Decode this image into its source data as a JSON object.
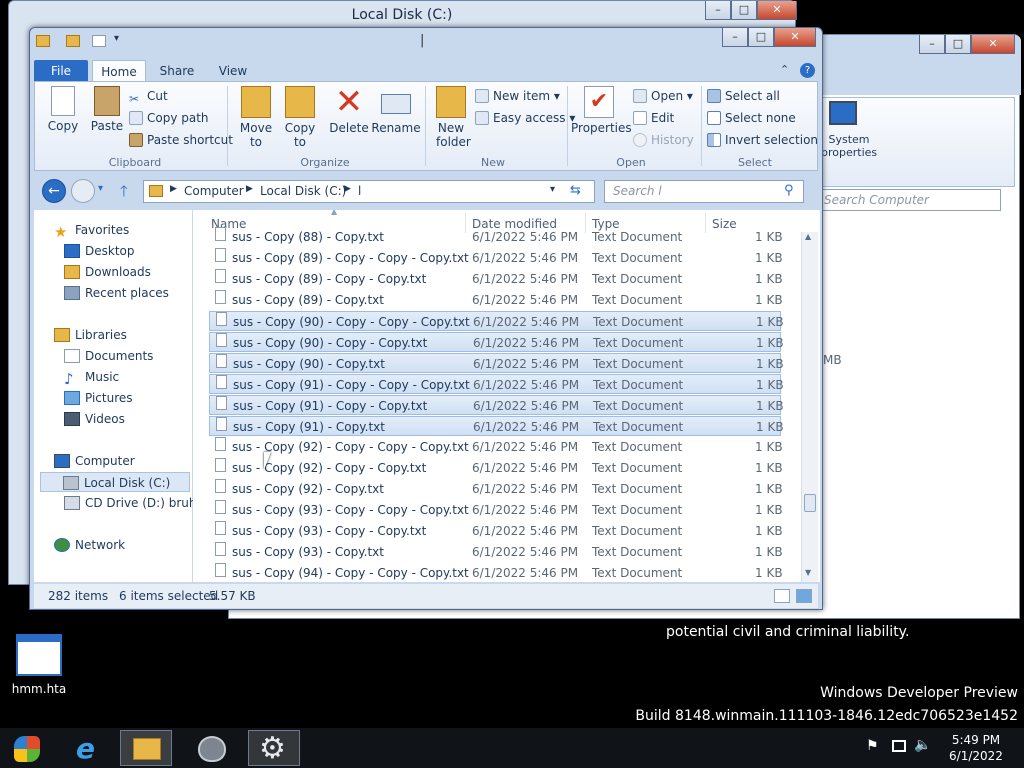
{
  "background_window": {
    "title": "Local Disk (C:)"
  },
  "back_right_window": {
    "search_placeholder": "Search Computer",
    "system_properties_label": "System properties",
    "partial_text": "MB"
  },
  "main_window": {
    "quick_access_cursor": "|",
    "ribbon_tabs": {
      "file": "File",
      "home": "Home",
      "share": "Share",
      "view": "View"
    },
    "ribbon": {
      "clipboard": {
        "copy": "Copy",
        "paste": "Paste",
        "cut": "Cut",
        "copy_path": "Copy path",
        "paste_shortcut": "Paste shortcut",
        "group": "Clipboard"
      },
      "organize": {
        "move_to": "Move to",
        "copy_to": "Copy to",
        "delete": "Delete",
        "rename": "Rename",
        "group": "Organize"
      },
      "new": {
        "new_folder": "New folder",
        "new_item": "New item",
        "easy_access": "Easy access",
        "group": "New"
      },
      "open": {
        "properties": "Properties",
        "open": "Open",
        "edit": "Edit",
        "history": "History",
        "group": "Open"
      },
      "select": {
        "select_all": "Select all",
        "select_none": "Select none",
        "invert_selection": "Invert selection",
        "group": "Select"
      }
    },
    "address": {
      "computer": "Computer",
      "local_disk": "Local Disk (C:)",
      "folder": "l"
    },
    "search_placeholder": "Search l",
    "navigation": {
      "favorites": "Favorites",
      "desktop": "Desktop",
      "downloads": "Downloads",
      "recent": "Recent places",
      "libraries": "Libraries",
      "documents": "Documents",
      "music": "Music",
      "pictures": "Pictures",
      "videos": "Videos",
      "computer": "Computer",
      "local_disk": "Local Disk (C:)",
      "cd_drive": "CD Drive (D:) bruh",
      "network": "Network"
    },
    "columns": {
      "name": "Name",
      "date": "Date modified",
      "type": "Type",
      "size": "Size"
    },
    "files": [
      {
        "name": "sus - Copy (88) - Copy.txt",
        "date": "6/1/2022 5:46 PM",
        "type": "Text Document",
        "size": "1 KB"
      },
      {
        "name": "sus - Copy (89) - Copy - Copy - Copy.txt",
        "date": "6/1/2022 5:46 PM",
        "type": "Text Document",
        "size": "1 KB"
      },
      {
        "name": "sus - Copy (89) - Copy - Copy.txt",
        "date": "6/1/2022 5:46 PM",
        "type": "Text Document",
        "size": "1 KB"
      },
      {
        "name": "sus - Copy (89) - Copy.txt",
        "date": "6/1/2022 5:46 PM",
        "type": "Text Document",
        "size": "1 KB"
      },
      {
        "name": "sus - Copy (90) - Copy - Copy - Copy.txt",
        "date": "6/1/2022 5:46 PM",
        "type": "Text Document",
        "size": "1 KB"
      },
      {
        "name": "sus - Copy (90) - Copy - Copy.txt",
        "date": "6/1/2022 5:46 PM",
        "type": "Text Document",
        "size": "1 KB"
      },
      {
        "name": "sus - Copy (90) - Copy.txt",
        "date": "6/1/2022 5:46 PM",
        "type": "Text Document",
        "size": "1 KB"
      },
      {
        "name": "sus - Copy (91) - Copy - Copy - Copy.txt",
        "date": "6/1/2022 5:46 PM",
        "type": "Text Document",
        "size": "1 KB"
      },
      {
        "name": "sus - Copy (91) - Copy - Copy.txt",
        "date": "6/1/2022 5:46 PM",
        "type": "Text Document",
        "size": "1 KB"
      },
      {
        "name": "sus - Copy (91) - Copy.txt",
        "date": "6/1/2022 5:46 PM",
        "type": "Text Document",
        "size": "1 KB"
      },
      {
        "name": "sus - Copy (92) - Copy - Copy - Copy.txt",
        "date": "6/1/2022 5:46 PM",
        "type": "Text Document",
        "size": "1 KB"
      },
      {
        "name": "sus - Copy (92) - Copy - Copy.txt",
        "date": "6/1/2022 5:46 PM",
        "type": "Text Document",
        "size": "1 KB"
      },
      {
        "name": "sus - Copy (92) - Copy.txt",
        "date": "6/1/2022 5:46 PM",
        "type": "Text Document",
        "size": "1 KB"
      },
      {
        "name": "sus - Copy (93) - Copy - Copy - Copy.txt",
        "date": "6/1/2022 5:46 PM",
        "type": "Text Document",
        "size": "1 KB"
      },
      {
        "name": "sus - Copy (93) - Copy - Copy.txt",
        "date": "6/1/2022 5:46 PM",
        "type": "Text Document",
        "size": "1 KB"
      },
      {
        "name": "sus - Copy (93) - Copy.txt",
        "date": "6/1/2022 5:46 PM",
        "type": "Text Document",
        "size": "1 KB"
      },
      {
        "name": "sus - Copy (94) - Copy - Copy - Copy.txt",
        "date": "6/1/2022 5:46 PM",
        "type": "Text Document",
        "size": "1 KB"
      }
    ],
    "selected_rows": [
      4,
      5,
      6,
      7,
      8,
      9
    ],
    "status": {
      "items": "282 items",
      "selected": "6 items selected",
      "size": "5.57 KB"
    }
  },
  "desktop": {
    "icon_label": "hmm.hta",
    "watermark_line1": "potential civil and criminal liability.",
    "watermark_line2": "Windows Developer Preview",
    "watermark_line3": "Build 8148.winmain.111103-1846.12edc706523e1452"
  },
  "taskbar": {
    "time": "5:49 PM",
    "date": "6/1/2022"
  },
  "colors": {
    "accent": "#2b6cc4",
    "selection": "#cfe0f4",
    "taskbar": "#101418"
  }
}
